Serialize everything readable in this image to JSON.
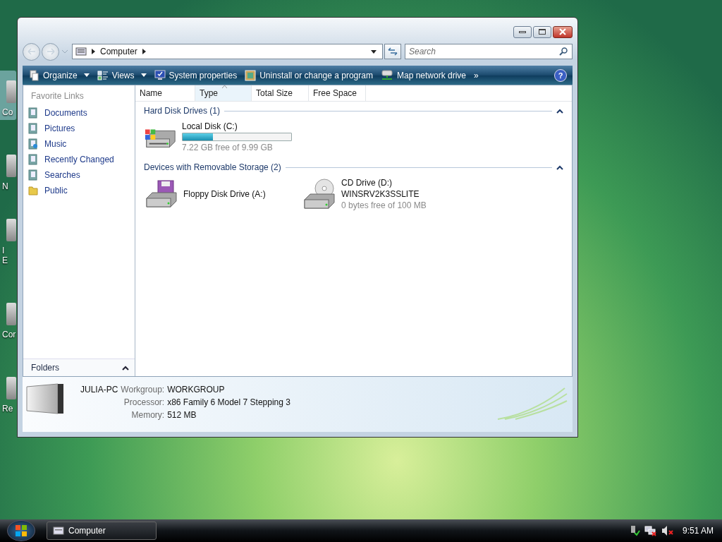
{
  "desktop_icons": [
    {
      "lines": [
        "Co"
      ],
      "selected": true
    },
    {
      "lines": [
        "N"
      ],
      "selected": false
    },
    {
      "lines": [
        "I",
        "E"
      ],
      "selected": false
    },
    {
      "lines": [
        "Cor"
      ],
      "selected": false
    },
    {
      "lines": [
        "Re"
      ],
      "selected": false
    }
  ],
  "window": {
    "address": {
      "crumbs": [
        "Computer"
      ]
    },
    "search": {
      "placeholder": "Search"
    },
    "toolbar": [
      {
        "kind": "organize",
        "label": "Organize",
        "dropdown": true
      },
      {
        "kind": "views",
        "label": "Views",
        "dropdown": true
      },
      {
        "kind": "system",
        "label": "System properties",
        "dropdown": false
      },
      {
        "kind": "uninstall",
        "label": "Uninstall or change a program",
        "dropdown": false
      },
      {
        "kind": "network",
        "label": "Map network drive",
        "dropdown": false
      }
    ],
    "toolbar_more": "»",
    "help": "?",
    "sidebar": {
      "title": "Favorite Links",
      "items": [
        {
          "kind": "documents",
          "label": "Documents"
        },
        {
          "kind": "pictures",
          "label": "Pictures"
        },
        {
          "kind": "music",
          "label": "Music"
        },
        {
          "kind": "recent",
          "label": "Recently Changed"
        },
        {
          "kind": "searches",
          "label": "Searches"
        },
        {
          "kind": "public",
          "label": "Public"
        }
      ],
      "folders": {
        "label": "Folders",
        "expanded": false
      }
    },
    "columns": [
      {
        "label": "Name",
        "sorted": false
      },
      {
        "label": "Type",
        "sorted": true
      },
      {
        "label": "Total Size",
        "sorted": false
      },
      {
        "label": "Free Space",
        "sorted": false
      }
    ],
    "groups": [
      {
        "title": "Hard Disk Drives (1)",
        "expanded": true,
        "items": [
          {
            "kind": "hdd",
            "name": "Local Disk (C:)",
            "level": 0.28,
            "free": "7.22 GB free of 9.99 GB"
          }
        ]
      },
      {
        "title": "Devices with Removable Storage (2)",
        "expanded": true,
        "items": [
          {
            "kind": "floppy",
            "name": "Floppy Disk Drive (A:)"
          },
          {
            "kind": "cd",
            "name": "CD Drive (D:)",
            "volume": "WINSRV2K3SSLITE",
            "free": "0 bytes free of 100 MB"
          }
        ]
      }
    ],
    "details": {
      "computer": "JULIA-PC",
      "fields": [
        {
          "label": "Workgroup:",
          "value": "WORKGROUP"
        },
        {
          "label": "Processor:",
          "value": "x86 Family 6 Model 7 Stepping 3"
        },
        {
          "label": "Memory:",
          "value": "512 MB"
        }
      ]
    }
  },
  "taskbar": {
    "tasks": [
      {
        "label": "Computer",
        "selected": true
      }
    ],
    "clock": "9:51 AM"
  }
}
